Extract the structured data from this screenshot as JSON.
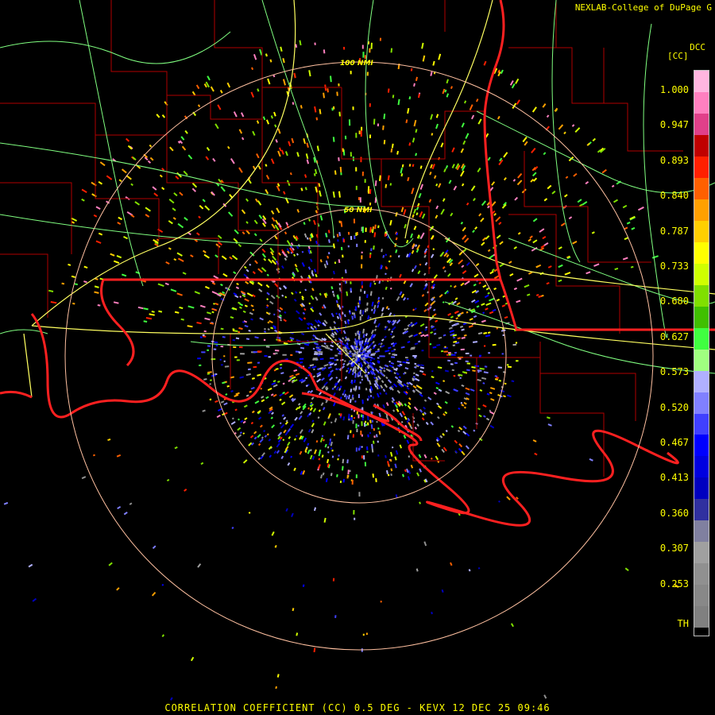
{
  "header": {
    "credit": "NEXLAB-College of DuPage G",
    "product_code": "DCC",
    "units": "[CC]"
  },
  "footer": {
    "title": "CORRELATION COEFFICIENT (CC) 0.5 DEG - KEVX 12 DEC 25 09:46"
  },
  "range_rings": [
    {
      "label": "100 NMI"
    },
    {
      "label": "50 NMI"
    }
  ],
  "legend": {
    "labels": [
      "1.000",
      "0.947",
      "0.893",
      "0.840",
      "0.787",
      "0.733",
      "0.680",
      "0.627",
      "0.573",
      "0.520",
      "0.467",
      "0.413",
      "0.360",
      "0.307",
      "0.253",
      "TH"
    ],
    "colors": [
      "#ffb6e0",
      "#ff80c0",
      "#e0408a",
      "#c00000",
      "#ff2000",
      "#ff6000",
      "#ffa000",
      "#ffd000",
      "#ffff00",
      "#d0ff00",
      "#80e000",
      "#40c000",
      "#40ff40",
      "#a0ff80",
      "#b0b0ff",
      "#8080ff",
      "#4040ff",
      "#0000ff",
      "#0000e0",
      "#0000c0",
      "#3030a0",
      "#8080a0",
      "#a0a0a0",
      "#909090",
      "#888888",
      "#808080",
      "#000000"
    ]
  },
  "colors": {
    "state_borders": "#ff2020",
    "county_lines": "#b00000",
    "highways": "#ffff60",
    "roads": "#80ff80",
    "range_rings": "#ffc0a0"
  }
}
